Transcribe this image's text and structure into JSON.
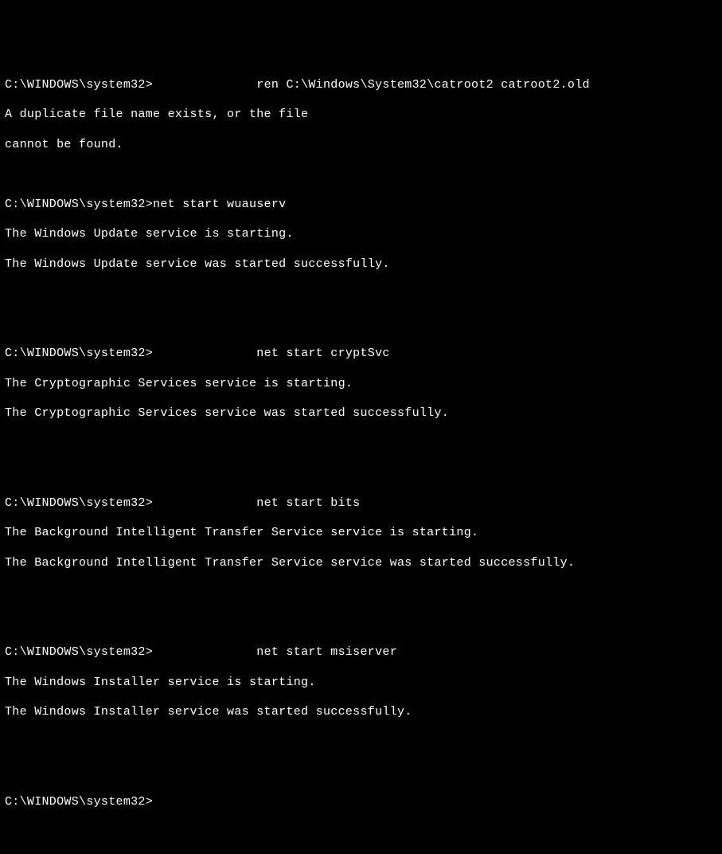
{
  "prompt": "C:\\WINDOWS\\system32>",
  "blocks": [
    {
      "cmd_pad": "              ",
      "cmd": "ren C:\\Windows\\System32\\catroot2 catroot2.old",
      "out": [
        "A duplicate file name exists, or the file",
        "cannot be found."
      ]
    },
    {
      "cmd_pad": "",
      "cmd": "net start wuauserv",
      "out": [
        "The Windows Update service is starting.",
        "The Windows Update service was started successfully."
      ]
    },
    {
      "cmd_pad": "              ",
      "cmd": "net start cryptSvc",
      "out": [
        "The Cryptographic Services service is starting.",
        "The Cryptographic Services service was started successfully."
      ]
    },
    {
      "cmd_pad": "              ",
      "cmd": "net start bits",
      "out": [
        "The Background Intelligent Transfer Service service is starting.",
        "The Background Intelligent Transfer Service service was started successfully."
      ]
    },
    {
      "cmd_pad": "              ",
      "cmd": "net start msiserver",
      "out": [
        "The Windows Installer service is starting.",
        "The Windows Installer service was started successfully."
      ]
    }
  ],
  "final_prompt": "C:\\WINDOWS\\system32>"
}
